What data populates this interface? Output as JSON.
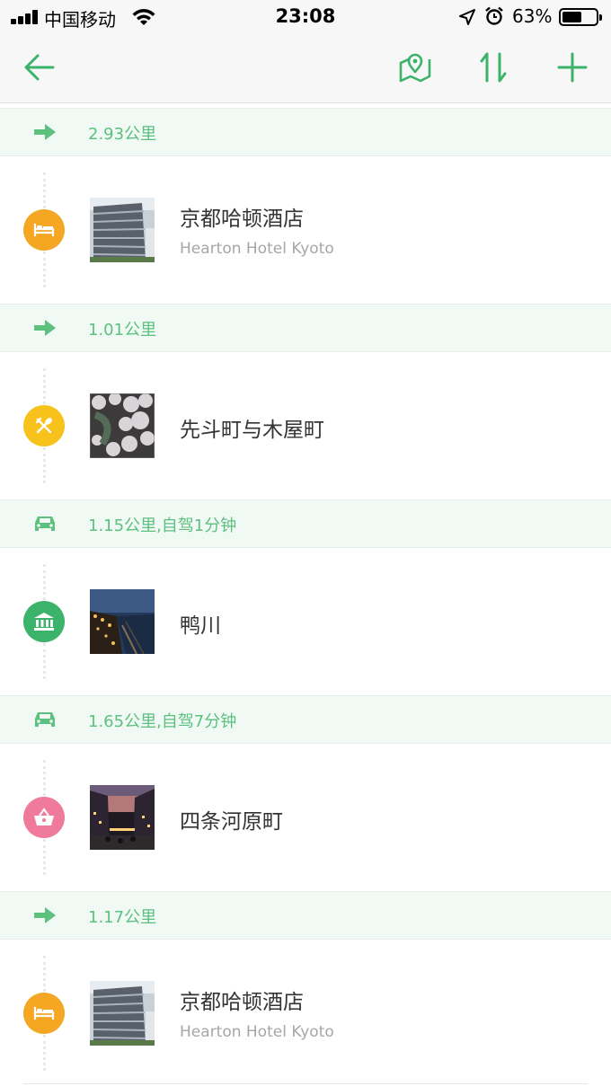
{
  "status_bar": {
    "carrier": "中国移动",
    "time": "23:08",
    "battery_percent": "63%",
    "battery_level": 0.63
  },
  "nav": {
    "back_icon": "arrow-left-icon",
    "map_icon": "map-pin-icon",
    "sort_icon": "sort-arrows-icon",
    "add_icon": "plus-icon",
    "accent_color": "#3bb36a"
  },
  "segments": [
    {
      "mode": "walk",
      "icon": "arrow-right-icon",
      "text": "2.93公里"
    },
    {
      "mode": "walk",
      "icon": "arrow-right-icon",
      "text": "1.01公里"
    },
    {
      "mode": "drive",
      "icon": "car-icon",
      "text": "1.15公里,自驾1分钟"
    },
    {
      "mode": "drive",
      "icon": "car-icon",
      "text": "1.65公里,自驾7分钟"
    },
    {
      "mode": "walk",
      "icon": "arrow-right-icon",
      "text": "1.17公里"
    }
  ],
  "places": [
    {
      "category": "hotel",
      "icon": "bed-icon",
      "color": "#f5a623",
      "name": "京都哈顿酒店",
      "subtitle": "Hearton Hotel Kyoto"
    },
    {
      "category": "food",
      "icon": "fork-spoon-icon",
      "color": "#f8c21c",
      "name": "先斗町与木屋町",
      "subtitle": ""
    },
    {
      "category": "sight",
      "icon": "museum-icon",
      "color": "#3bb36a",
      "name": "鸭川",
      "subtitle": ""
    },
    {
      "category": "shopping",
      "icon": "basket-icon",
      "color": "#f07a9b",
      "name": "四条河原町",
      "subtitle": ""
    },
    {
      "category": "hotel",
      "icon": "bed-icon",
      "color": "#f5a623",
      "name": "京都哈顿酒店",
      "subtitle": "Hearton Hotel Kyoto"
    }
  ]
}
